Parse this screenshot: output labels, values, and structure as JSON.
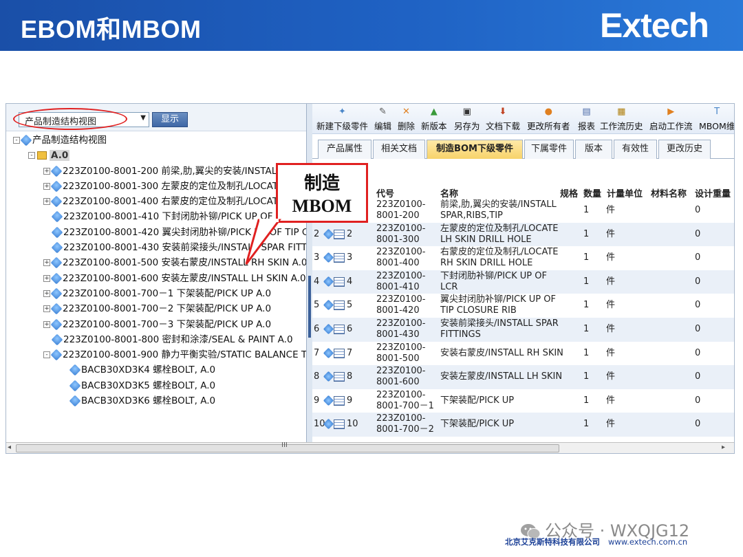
{
  "header": {
    "title": "EBOM和MBOM",
    "logo": "Extech"
  },
  "left": {
    "view_select": "产品制造结构视图",
    "show_button": "显示",
    "tree": [
      {
        "label": "产品制造结构视图",
        "level": 0,
        "exp": "-",
        "icon": "node"
      },
      {
        "label": "A.0",
        "level": 1,
        "exp": "-",
        "icon": "folder",
        "root": true
      },
      {
        "label": "223Z0100-8001-200 前梁,肋,翼尖的安装/INSTALL S",
        "level": 2,
        "exp": "+",
        "icon": "node"
      },
      {
        "label": "223Z0100-8001-300 左蒙皮的定位及制孔/LOCATE L",
        "level": 2,
        "exp": "+",
        "icon": "node"
      },
      {
        "label": "223Z0100-8001-400 右蒙皮的定位及制孔/LOCATE R",
        "level": 2,
        "exp": "+",
        "icon": "node"
      },
      {
        "label": "223Z0100-8001-410 下封闭肋补铆/PICK UP OF LCR",
        "level": 2,
        "exp": "",
        "icon": "node"
      },
      {
        "label": "223Z0100-8001-420 翼尖封闭肋补铆/PICK UP OF TIP CLO",
        "level": 2,
        "exp": "",
        "icon": "node"
      },
      {
        "label": "223Z0100-8001-430 安装前梁接头/INSTALL SPAR FITTING",
        "level": 2,
        "exp": "",
        "icon": "node"
      },
      {
        "label": "223Z0100-8001-500 安装右蒙皮/INSTALL RH SKIN A.0",
        "level": 2,
        "exp": "+",
        "icon": "node"
      },
      {
        "label": "223Z0100-8001-600 安装左蒙皮/INSTALL LH SKIN A.0",
        "level": 2,
        "exp": "+",
        "icon": "node"
      },
      {
        "label": "223Z0100-8001-700－1 下架装配/PICK UP A.0",
        "level": 2,
        "exp": "+",
        "icon": "node"
      },
      {
        "label": "223Z0100-8001-700－2 下架装配/PICK UP A.0",
        "level": 2,
        "exp": "+",
        "icon": "node"
      },
      {
        "label": "223Z0100-8001-700－3 下架装配/PICK UP A.0",
        "level": 2,
        "exp": "+",
        "icon": "node"
      },
      {
        "label": "223Z0100-8001-800 密封和涂漆/SEAL & PAINT A.0",
        "level": 2,
        "exp": "",
        "icon": "node"
      },
      {
        "label": "223Z0100-8001-900 静力平衡实验/STATIC BALANCE TES",
        "level": 2,
        "exp": "-",
        "icon": "node"
      },
      {
        "label": "BACB30XD3K4 螺栓BOLT, A.0",
        "level": 3,
        "exp": "",
        "icon": "node"
      },
      {
        "label": "BACB30XD3K5 螺栓BOLT, A.0",
        "level": 3,
        "exp": "",
        "icon": "node"
      },
      {
        "label": "BACB30XD3K6 螺栓BOLT, A.0",
        "level": 3,
        "exp": "",
        "icon": "node"
      }
    ]
  },
  "toolbar": [
    {
      "label": "新建下级零件",
      "icon": "new-child-icon",
      "glyph": "✦",
      "color": "#4a86c8"
    },
    {
      "label": "编辑",
      "icon": "edit-icon",
      "glyph": "✎",
      "color": "#555555"
    },
    {
      "label": "删除",
      "icon": "delete-icon",
      "glyph": "✕",
      "color": "#e08020"
    },
    {
      "label": "新版本",
      "icon": "new-version-icon",
      "glyph": "▲",
      "color": "#3a9a3a"
    },
    {
      "label": "另存为",
      "icon": "save-as-icon",
      "glyph": "▣",
      "color": "#333333"
    },
    {
      "label": "文档下载",
      "icon": "download-icon",
      "glyph": "⬇",
      "color": "#c04020"
    },
    {
      "label": "更改所有者",
      "icon": "owner-icon",
      "glyph": "●",
      "color": "#e08020"
    },
    {
      "label": "报表",
      "icon": "report-icon",
      "glyph": "▤",
      "color": "#4a6aa8"
    },
    {
      "label": "工作流历史",
      "icon": "workflow-history-icon",
      "glyph": "▦",
      "color": "#b08010"
    },
    {
      "label": "启动工作流",
      "icon": "start-workflow-icon",
      "glyph": "▶",
      "color": "#e08020"
    },
    {
      "label": "MBOM维",
      "icon": "mbom-icon",
      "glyph": "T",
      "color": "#4a86c8"
    }
  ],
  "tabs": [
    {
      "label": "产品属性",
      "active": false
    },
    {
      "label": "相关文档",
      "active": false
    },
    {
      "label": "制造BOM下级零件",
      "active": true
    },
    {
      "label": "下属零件",
      "active": false
    },
    {
      "label": "版本",
      "active": false
    },
    {
      "label": "有效性",
      "active": false
    },
    {
      "label": "更改历史",
      "active": false
    }
  ],
  "grid": {
    "headers": [
      "代号",
      "名称",
      "规格",
      "数量",
      "计量单位",
      "材料名称",
      "设计重量"
    ],
    "rows": [
      {
        "no": "",
        "code1": "223Z0100-",
        "code2": "8001-200",
        "name1": "前梁,肋,翼尖的安装/INSTALL",
        "name2": "SPAR,RIBS,TIP",
        "qty": "1",
        "unit": "件",
        "weight": "0"
      },
      {
        "no": "2",
        "code1": "223Z0100-",
        "code2": "8001-300",
        "name1": "左蒙皮的定位及制孔/LOCATE",
        "name2": "LH SKIN DRILL HOLE",
        "qty": "1",
        "unit": "件",
        "weight": "0"
      },
      {
        "no": "3",
        "code1": "223Z0100-",
        "code2": "8001-400",
        "name1": "右蒙皮的定位及制孔/LOCATE",
        "name2": "RH SKIN DRILL HOLE",
        "qty": "1",
        "unit": "件",
        "weight": "0"
      },
      {
        "no": "4",
        "code1": "223Z0100-",
        "code2": "8001-410",
        "name1": "下封闭肋补铆/PICK UP OF",
        "name2": "LCR",
        "qty": "1",
        "unit": "件",
        "weight": "0"
      },
      {
        "no": "5",
        "code1": "223Z0100-",
        "code2": "8001-420",
        "name1": "翼尖封闭肋补铆/PICK UP OF",
        "name2": "TIP CLOSURE RIB",
        "qty": "1",
        "unit": "件",
        "weight": "0"
      },
      {
        "no": "6",
        "code1": "223Z0100-",
        "code2": "8001-430",
        "name1": "安装前梁接头/INSTALL SPAR",
        "name2": "FITTINGS",
        "qty": "1",
        "unit": "件",
        "weight": "0"
      },
      {
        "no": "7",
        "code1": "223Z0100-",
        "code2": "8001-500",
        "name1": "安装右蒙皮/INSTALL RH SKIN",
        "name2": "",
        "qty": "1",
        "unit": "件",
        "weight": "0"
      },
      {
        "no": "8",
        "code1": "223Z0100-",
        "code2": "8001-600",
        "name1": "安装左蒙皮/INSTALL LH SKIN",
        "name2": "",
        "qty": "1",
        "unit": "件",
        "weight": "0"
      },
      {
        "no": "9",
        "code1": "223Z0100-",
        "code2": "8001-700－1",
        "name1": "下架装配/PICK UP",
        "name2": "",
        "qty": "1",
        "unit": "件",
        "weight": "0"
      },
      {
        "no": "10",
        "code1": "223Z0100-",
        "code2": "8001-700－2",
        "name1": "下架装配/PICK UP",
        "name2": "",
        "qty": "1",
        "unit": "件",
        "weight": "0"
      }
    ]
  },
  "callout": {
    "line1": "制造",
    "line2": "MBOM"
  },
  "hscroll_grip": "III",
  "footer": {
    "watermark": "公众号 · WXQJG12",
    "company": "北京艾克斯特科技有限公司",
    "url": "www.extech.com.cn"
  }
}
